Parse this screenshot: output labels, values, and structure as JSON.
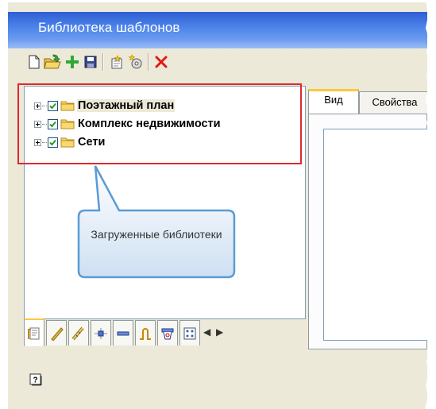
{
  "window": {
    "title": "Библиотека шаблонов"
  },
  "toolbar": {
    "buttons": [
      {
        "name": "new-file-icon"
      },
      {
        "name": "open-folder-icon"
      },
      {
        "name": "add-icon"
      },
      {
        "name": "save-icon"
      },
      {
        "name": "new-item-icon"
      },
      {
        "name": "new-item-settings-icon"
      },
      {
        "name": "delete-icon"
      }
    ]
  },
  "tree": {
    "items": [
      {
        "label": "Поэтажный план",
        "checked": true,
        "expanded": false,
        "selected": true
      },
      {
        "label": "Комплекс недвижимости",
        "checked": true,
        "expanded": false,
        "selected": false
      },
      {
        "label": "Сети",
        "checked": true,
        "expanded": false,
        "selected": false
      }
    ]
  },
  "annotation": {
    "callout_text": "Загруженные библиотеки",
    "highlight_color": "#e0282e",
    "callout_color": "#5b9bd5"
  },
  "bottom_tabs": [
    {
      "name": "floor-plan-tab-icon"
    },
    {
      "name": "ruler-tab-icon"
    },
    {
      "name": "pipe-tab-icon"
    },
    {
      "name": "junction-tab-icon"
    },
    {
      "name": "segment-tab-icon"
    },
    {
      "name": "arc-tab-icon"
    },
    {
      "name": "fixture-tab-icon"
    },
    {
      "name": "grid-tab-icon"
    }
  ],
  "right_tabs": [
    {
      "label": "Вид"
    },
    {
      "label": "Свойства"
    }
  ],
  "colors": {
    "titlebar": "#4f86ea",
    "window_bg": "#ece9d8",
    "tab_accent": "#ffc73c"
  }
}
